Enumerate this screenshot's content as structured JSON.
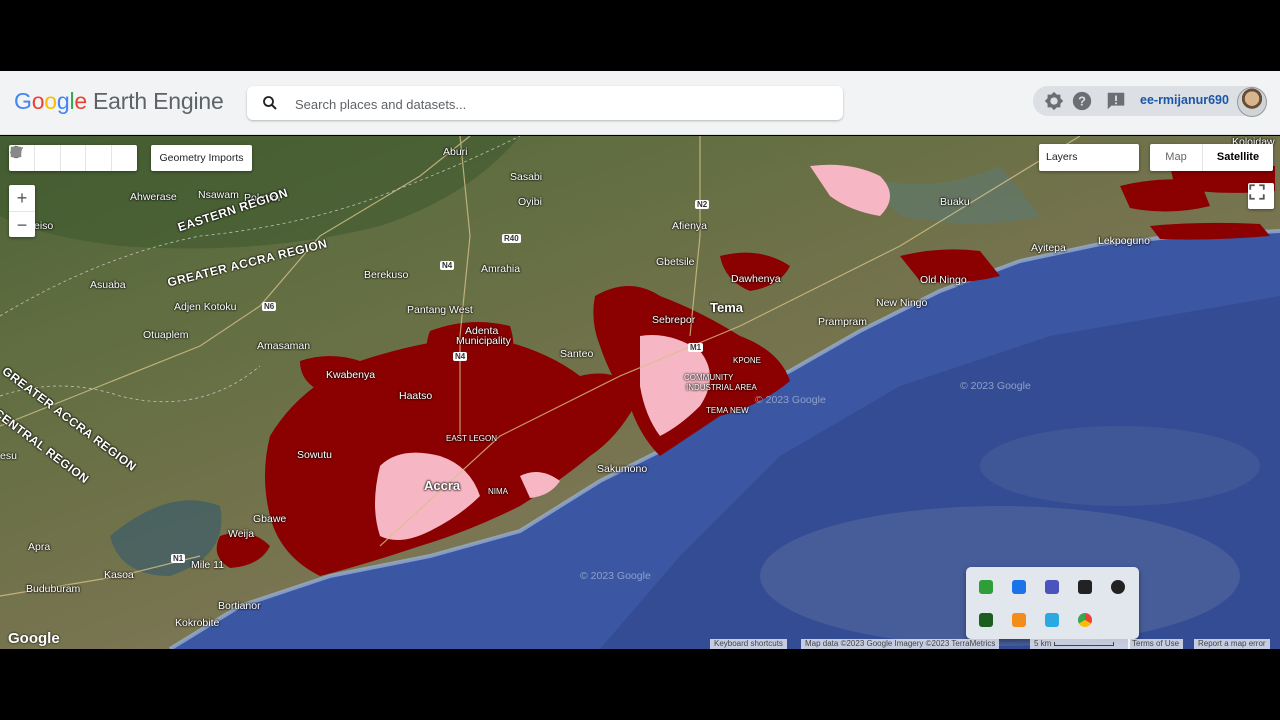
{
  "app": {
    "logo_letters": [
      "G",
      "o",
      "o",
      "g",
      "l",
      "e"
    ],
    "logo_rest": "Earth Engine"
  },
  "search": {
    "placeholder": "Search places and datasets..."
  },
  "user": {
    "name": "ee-rmijanur690"
  },
  "icons": {
    "header": [
      "brightness-icon",
      "help-icon",
      "feedback-icon"
    ],
    "toolbar": [
      "pan-hand-icon",
      "marker-icon",
      "line-icon",
      "polygon-icon",
      "rectangle-icon"
    ]
  },
  "map": {
    "geometry_imports_label": "Geometry Imports",
    "layers_label": "Layers",
    "map_type": {
      "map": "Map",
      "satellite": "Satellite",
      "selected": "Satellite"
    },
    "zoom_in": "+",
    "zoom_out": "−",
    "google_logo": "Google",
    "attribution": {
      "shortcuts": "Keyboard shortcuts",
      "data": "Map data ©2023 Google Imagery ©2023 TerraMetrics",
      "scale": "5 km",
      "terms": "Terms of Use",
      "report": "Report a map error"
    },
    "labels": {
      "aburi": "Aburi",
      "koloidaw": "Koloidaw",
      "sasabi": "Sasabi",
      "ahwerase": "Ahwerase",
      "nsawam": "Nsawam",
      "pokrom": "Pokrom",
      "oyibi": "Oyibi",
      "buaku": "Buaku",
      "afienya": "Afienya",
      "eastern_region": "EASTERN REGION",
      "greater_accra_region": "GREATER ACCRA REGION",
      "berekuso": "Berekuso",
      "amrahia": "Amrahia",
      "gbetsile": "Gbetsile",
      "dawhenya": "Dawhenya",
      "old_ningo": "Old Ningo",
      "ayitepa": "Ayitepa",
      "lekpoguno": "Lekpoguno",
      "asuaba": "Asuaba",
      "adjen_kotoku": "Adjen Kotoku",
      "pantang_west": "Pantang West",
      "sebrepor": "Sebrepor",
      "tema": "Tema",
      "new_ningo": "New Ningo",
      "prampram": "Prampram",
      "otuaplem": "Otuaplem",
      "amasaman": "Amasaman",
      "adenta": "Adenta",
      "municipality": "Municipality",
      "santeo": "Santeo",
      "kwabenya": "Kwabenya",
      "haatso": "Haatso",
      "greater_accra_region_diag": "GREATER ACCRA REGION",
      "central_region": "CENTRAL REGION",
      "sowutu": "Sowutu",
      "accra": "Accra",
      "sakumono": "Sakumono",
      "gbawe": "Gbawe",
      "weija": "Weija",
      "apra": "Apra",
      "mile_11": "Mile 11",
      "kasoa": "Kasoa",
      "buduburam": "Buduburam",
      "bortianor": "Bortianor",
      "kokrobite": "Kokrobite",
      "esu": "esu",
      "eiso": "eiso",
      "copyright_1": "© 2023 Google",
      "copyright_2": "© 2023 Google",
      "copyright_3": "© 2023 Google",
      "east_legon": "EAST LEGON",
      "nima": "NIMA",
      "community": "COMMUNITY",
      "industrial_area": "INDUSTRIAL AREA",
      "tema_new": "TEMA NEW",
      "kpone": "KPONE"
    },
    "shields": {
      "n2": "N2",
      "r40": "R40",
      "n4": "N4",
      "n6": "N6",
      "n4b": "N4",
      "m1": "M1",
      "n1": "N1"
    }
  }
}
